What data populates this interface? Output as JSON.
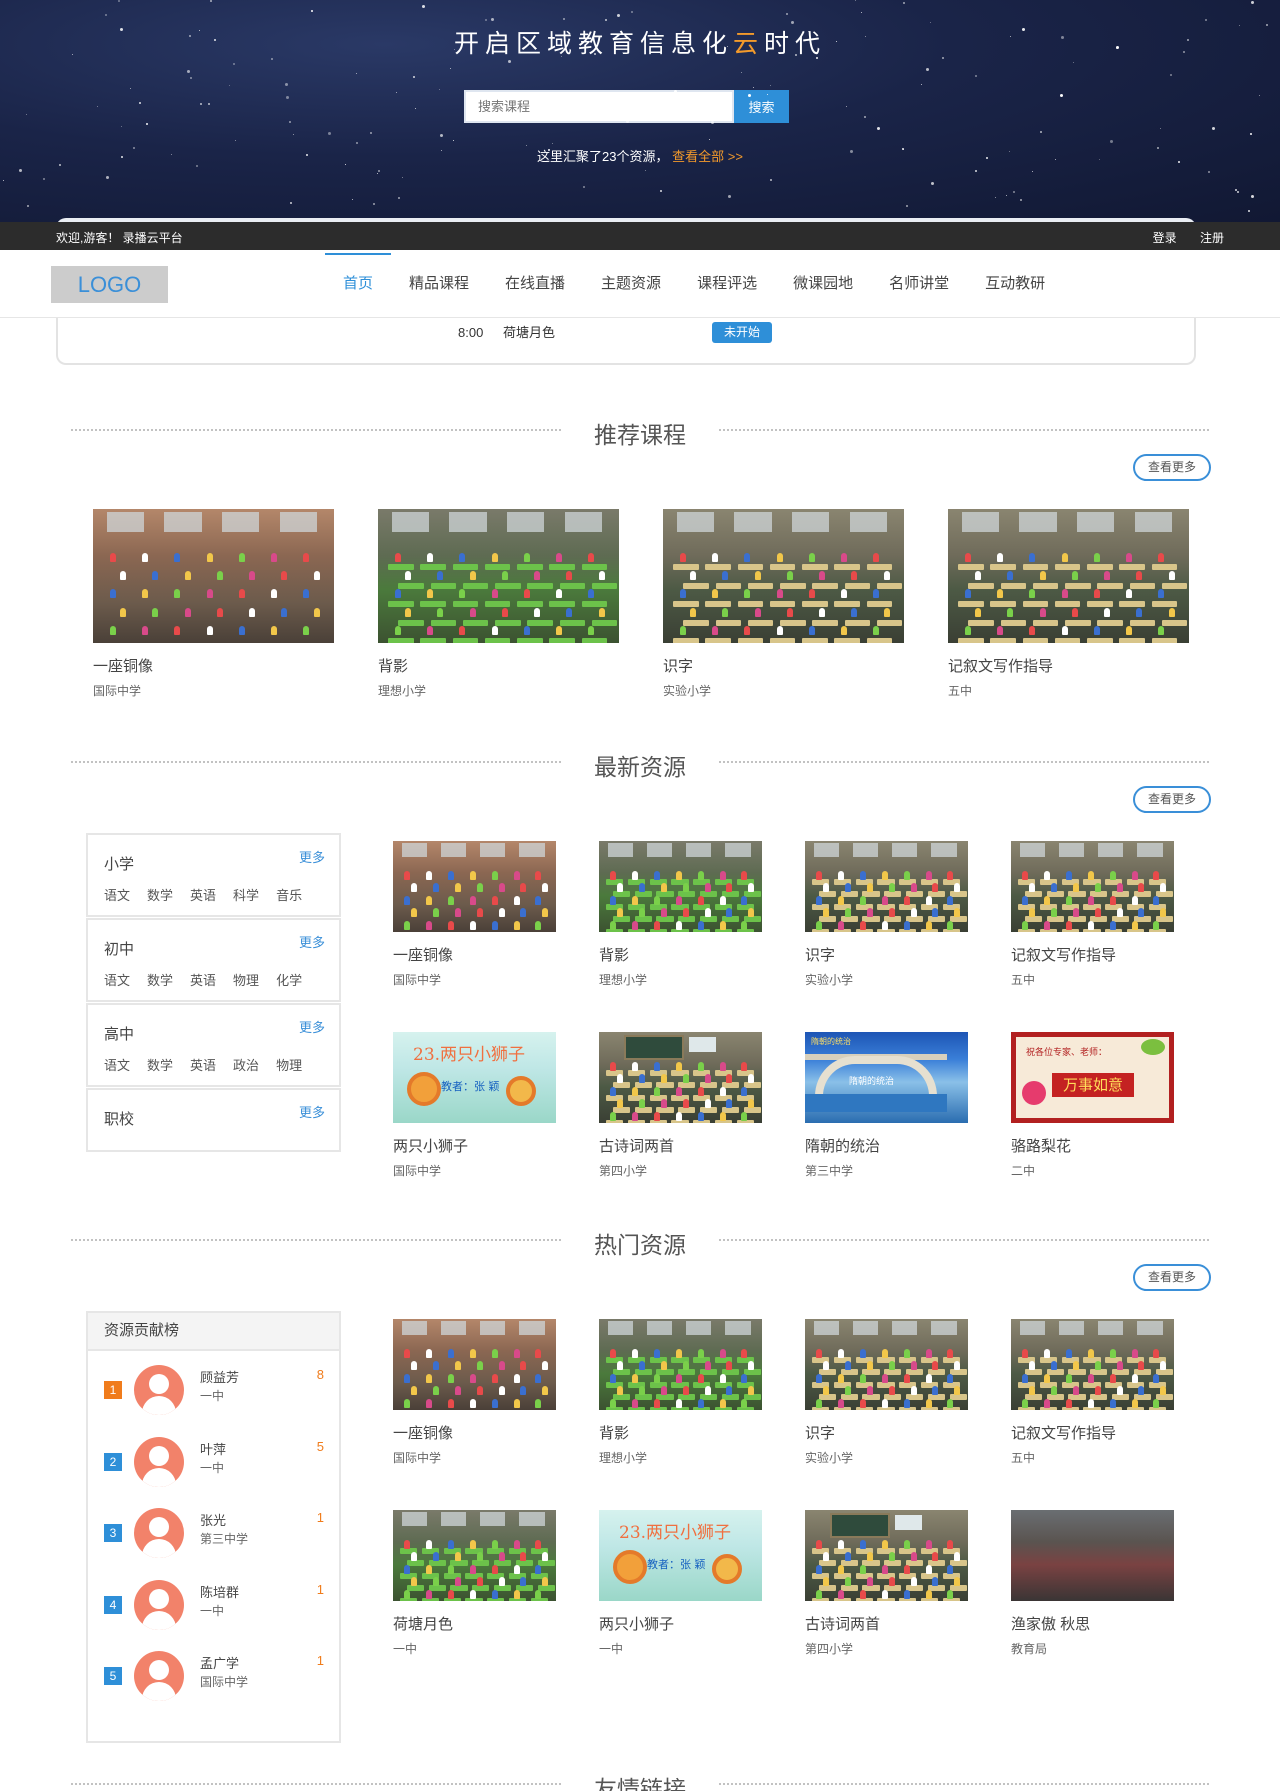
{
  "hero": {
    "title_pre": "开启区域教育信息化",
    "title_accent": "云",
    "title_post": "时代",
    "search_placeholder": "搜索课程",
    "search_button": "搜索",
    "note_text": "这里汇聚了23个资源，",
    "note_link": "查看全部 >>"
  },
  "topbar": {
    "welcome": "欢迎,游客！ 录播云平台",
    "login": "登录",
    "register": "注册"
  },
  "nav": {
    "logo": "LOGO",
    "items": [
      "首页",
      "精品课程",
      "在线直播",
      "主题资源",
      "课程评选",
      "微课园地",
      "名师讲堂",
      "互动教研"
    ],
    "active_index": 0
  },
  "schedule": {
    "time": "8:00",
    "title": "荷塘月色",
    "status": "未开始"
  },
  "sections": {
    "recommended": "推荐课程",
    "latest": "最新资源",
    "hot": "热门资源",
    "links": "友情链接",
    "more": "查看更多"
  },
  "recommended": [
    {
      "name": "一座铜像",
      "school": "国际中学",
      "thumb": "kids"
    },
    {
      "name": "背影",
      "school": "理想小学",
      "thumb": "green"
    },
    {
      "name": "识字",
      "school": "实验小学",
      "thumb": "class"
    },
    {
      "name": "记叙文写作指导",
      "school": "五中",
      "thumb": "class"
    }
  ],
  "categories": [
    {
      "name": "小学",
      "more": "更多",
      "subjects": [
        "语文",
        "数学",
        "英语",
        "科学",
        "音乐"
      ]
    },
    {
      "name": "初中",
      "more": "更多",
      "subjects": [
        "语文",
        "数学",
        "英语",
        "物理",
        "化学"
      ]
    },
    {
      "name": "高中",
      "more": "更多",
      "subjects": [
        "语文",
        "数学",
        "英语",
        "政治",
        "物理"
      ]
    },
    {
      "name": "职校",
      "more": "更多",
      "subjects": []
    }
  ],
  "latest": [
    {
      "name": "一座铜像",
      "school": "国际中学",
      "thumb": "kids"
    },
    {
      "name": "背影",
      "school": "理想小学",
      "thumb": "green"
    },
    {
      "name": "识字",
      "school": "实验小学",
      "thumb": "class"
    },
    {
      "name": "记叙文写作指导",
      "school": "五中",
      "thumb": "class"
    },
    {
      "name": "两只小狮子",
      "school": "国际中学",
      "thumb": "lion"
    },
    {
      "name": "古诗词两首",
      "school": "第四小学",
      "thumb": "board"
    },
    {
      "name": "隋朝的统治",
      "school": "第三中学",
      "thumb": "bridge"
    },
    {
      "name": "骆路梨花",
      "school": "二中",
      "thumb": "poster"
    }
  ],
  "ranking": {
    "title": "资源贡献榜",
    "items": [
      {
        "rank": "1",
        "name": "顾益芳",
        "school": "一中",
        "score": "8"
      },
      {
        "rank": "2",
        "name": "叶萍",
        "school": "一中",
        "score": "5"
      },
      {
        "rank": "3",
        "name": "张光",
        "school": "第三中学",
        "score": "1"
      },
      {
        "rank": "4",
        "name": "陈培群",
        "school": "一中",
        "score": "1"
      },
      {
        "rank": "5",
        "name": "孟广学",
        "school": "国际中学",
        "score": "1"
      }
    ]
  },
  "hot": [
    {
      "name": "一座铜像",
      "school": "国际中学",
      "thumb": "kids"
    },
    {
      "name": "背影",
      "school": "理想小学",
      "thumb": "green"
    },
    {
      "name": "识字",
      "school": "实验小学",
      "thumb": "class"
    },
    {
      "name": "记叙文写作指导",
      "school": "五中",
      "thumb": "class"
    },
    {
      "name": "荷塘月色",
      "school": "一中",
      "thumb": "green"
    },
    {
      "name": "两只小狮子",
      "school": "一中",
      "thumb": "lion"
    },
    {
      "name": "古诗词两首",
      "school": "第四小学",
      "thumb": "board"
    },
    {
      "name": "渔家傲 秋思",
      "school": "教育局",
      "thumb": "hall"
    }
  ],
  "thumb_texts": {
    "lion_title": "23.两只小狮子",
    "lion_sub": "教者：张 颖",
    "bridge_top": "隋朝的统治",
    "bridge_cap": "隋朝的统治",
    "poster_head": "祝各位专家、老师：",
    "poster_main": "万事如意"
  },
  "colors": {
    "accent": "#2e8fd8",
    "highlight": "#f39a2b",
    "topbar": "#2c2c2c"
  }
}
